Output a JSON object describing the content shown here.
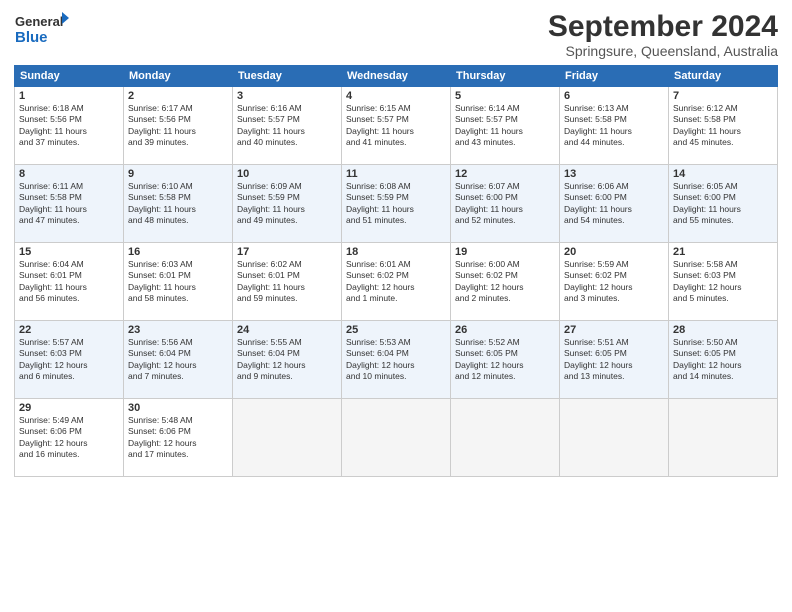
{
  "header": {
    "logo_line1": "General",
    "logo_line2": "Blue",
    "title": "September 2024",
    "subtitle": "Springsure, Queensland, Australia"
  },
  "weekdays": [
    "Sunday",
    "Monday",
    "Tuesday",
    "Wednesday",
    "Thursday",
    "Friday",
    "Saturday"
  ],
  "weeks": [
    [
      {
        "day": "1",
        "rise": "6:18 AM",
        "set": "5:56 PM",
        "hours": "11 hours",
        "mins": "37 minutes"
      },
      {
        "day": "2",
        "rise": "6:17 AM",
        "set": "5:56 PM",
        "hours": "11 hours",
        "mins": "39 minutes"
      },
      {
        "day": "3",
        "rise": "6:16 AM",
        "set": "5:57 PM",
        "hours": "11 hours",
        "mins": "40 minutes"
      },
      {
        "day": "4",
        "rise": "6:15 AM",
        "set": "5:57 PM",
        "hours": "11 hours",
        "mins": "41 minutes"
      },
      {
        "day": "5",
        "rise": "6:14 AM",
        "set": "5:57 PM",
        "hours": "11 hours",
        "mins": "43 minutes"
      },
      {
        "day": "6",
        "rise": "6:13 AM",
        "set": "5:58 PM",
        "hours": "11 hours",
        "mins": "44 minutes"
      },
      {
        "day": "7",
        "rise": "6:12 AM",
        "set": "5:58 PM",
        "hours": "11 hours",
        "mins": "45 minutes"
      }
    ],
    [
      {
        "day": "8",
        "rise": "6:11 AM",
        "set": "5:58 PM",
        "hours": "11 hours",
        "mins": "47 minutes"
      },
      {
        "day": "9",
        "rise": "6:10 AM",
        "set": "5:58 PM",
        "hours": "11 hours",
        "mins": "48 minutes"
      },
      {
        "day": "10",
        "rise": "6:09 AM",
        "set": "5:59 PM",
        "hours": "11 hours",
        "mins": "49 minutes"
      },
      {
        "day": "11",
        "rise": "6:08 AM",
        "set": "5:59 PM",
        "hours": "11 hours",
        "mins": "51 minutes"
      },
      {
        "day": "12",
        "rise": "6:07 AM",
        "set": "6:00 PM",
        "hours": "11 hours",
        "mins": "52 minutes"
      },
      {
        "day": "13",
        "rise": "6:06 AM",
        "set": "6:00 PM",
        "hours": "11 hours",
        "mins": "54 minutes"
      },
      {
        "day": "14",
        "rise": "6:05 AM",
        "set": "6:00 PM",
        "hours": "11 hours",
        "mins": "55 minutes"
      }
    ],
    [
      {
        "day": "15",
        "rise": "6:04 AM",
        "set": "6:01 PM",
        "hours": "11 hours",
        "mins": "56 minutes"
      },
      {
        "day": "16",
        "rise": "6:03 AM",
        "set": "6:01 PM",
        "hours": "11 hours",
        "mins": "58 minutes"
      },
      {
        "day": "17",
        "rise": "6:02 AM",
        "set": "6:01 PM",
        "hours": "11 hours",
        "mins": "59 minutes"
      },
      {
        "day": "18",
        "rise": "6:01 AM",
        "set": "6:02 PM",
        "hours": "12 hours",
        "mins": "1 minute"
      },
      {
        "day": "19",
        "rise": "6:00 AM",
        "set": "6:02 PM",
        "hours": "12 hours",
        "mins": "2 minutes"
      },
      {
        "day": "20",
        "rise": "5:59 AM",
        "set": "6:02 PM",
        "hours": "12 hours",
        "mins": "3 minutes"
      },
      {
        "day": "21",
        "rise": "5:58 AM",
        "set": "6:03 PM",
        "hours": "12 hours",
        "mins": "5 minutes"
      }
    ],
    [
      {
        "day": "22",
        "rise": "5:57 AM",
        "set": "6:03 PM",
        "hours": "12 hours",
        "mins": "6 minutes"
      },
      {
        "day": "23",
        "rise": "5:56 AM",
        "set": "6:04 PM",
        "hours": "12 hours",
        "mins": "7 minutes"
      },
      {
        "day": "24",
        "rise": "5:55 AM",
        "set": "6:04 PM",
        "hours": "12 hours",
        "mins": "9 minutes"
      },
      {
        "day": "25",
        "rise": "5:53 AM",
        "set": "6:04 PM",
        "hours": "12 hours",
        "mins": "10 minutes"
      },
      {
        "day": "26",
        "rise": "5:52 AM",
        "set": "6:05 PM",
        "hours": "12 hours",
        "mins": "12 minutes"
      },
      {
        "day": "27",
        "rise": "5:51 AM",
        "set": "6:05 PM",
        "hours": "12 hours",
        "mins": "13 minutes"
      },
      {
        "day": "28",
        "rise": "5:50 AM",
        "set": "6:05 PM",
        "hours": "12 hours",
        "mins": "14 minutes"
      }
    ],
    [
      {
        "day": "29",
        "rise": "5:49 AM",
        "set": "6:06 PM",
        "hours": "12 hours",
        "mins": "16 minutes"
      },
      {
        "day": "30",
        "rise": "5:48 AM",
        "set": "6:06 PM",
        "hours": "12 hours",
        "mins": "17 minutes"
      },
      null,
      null,
      null,
      null,
      null
    ]
  ]
}
